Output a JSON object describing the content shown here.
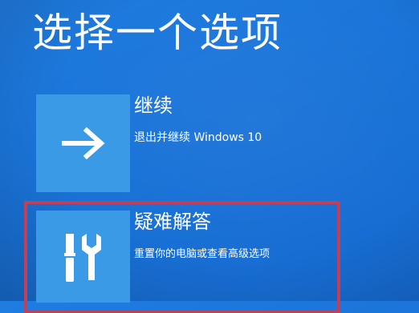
{
  "page": {
    "title": "选择一个选项"
  },
  "options": [
    {
      "id": "continue",
      "label": "继续",
      "description": "退出并继续 Windows 10",
      "icon": "arrow-right-icon"
    },
    {
      "id": "troubleshoot",
      "label": "疑难解答",
      "description": "重置你的电脑或查看高级选项",
      "icon": "tools-icon"
    }
  ],
  "colors": {
    "background": "#1a73d8",
    "tile": "#3a9ae6",
    "highlight_frame": "#c0405a",
    "text": "#ffffff"
  }
}
